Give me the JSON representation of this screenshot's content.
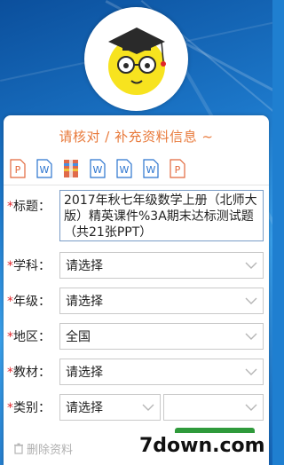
{
  "form": {
    "heading": "请核对 / 补充资料信息 ~",
    "file_types": [
      {
        "icon": "ppt-icon",
        "letter": "P",
        "color": "#e2683c"
      },
      {
        "icon": "word-icon",
        "letter": "W",
        "color": "#2b74cf"
      },
      {
        "icon": "archive-icon",
        "letter": "",
        "color": "#e06a4a"
      },
      {
        "icon": "word-icon",
        "letter": "W",
        "color": "#2b74cf"
      },
      {
        "icon": "word-icon",
        "letter": "W",
        "color": "#2b74cf"
      },
      {
        "icon": "word-icon",
        "letter": "W",
        "color": "#2b74cf"
      },
      {
        "icon": "ppt-icon",
        "letter": "P",
        "color": "#e2683c"
      }
    ],
    "title_label": "标题：",
    "title_value": "2017年秋七年级数学上册（北师大版）精英课件%3A期末达标测试题 （共21张PPT）",
    "subject_label": "学科：",
    "subject_value": "请选择",
    "grade_label": "年级：",
    "grade_value": "请选择",
    "region_label": "地区：",
    "region_value": "全国",
    "textbook_label": "教材：",
    "textbook_value": "请选择",
    "category_label": "类别：",
    "category_value": "请选择",
    "category_sub_value": "",
    "required_mark": "*",
    "delete_label": "删除资料"
  },
  "watermark": "7down.com",
  "colors": {
    "accent": "#e8793a",
    "required": "#e0242a",
    "bg_blue": "#1c77c9"
  }
}
